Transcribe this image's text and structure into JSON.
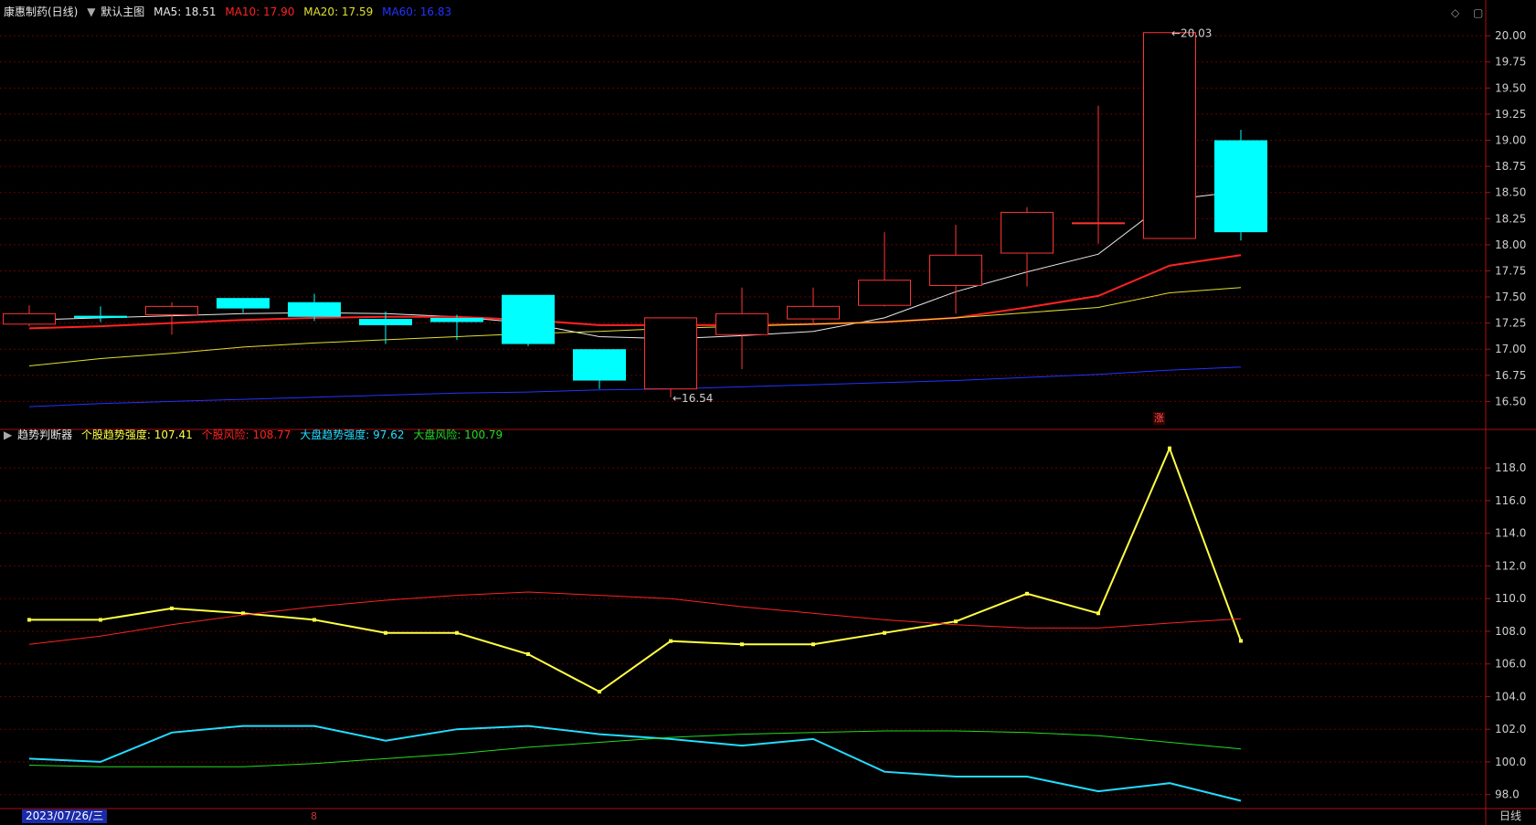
{
  "top_header": {
    "title": "康惠制药(日线)",
    "template_label": "默认主图",
    "indicators": [
      {
        "label": "MA5: 18.51",
        "color": "#e8e8e8"
      },
      {
        "label": "MA10: 17.90",
        "color": "#ff2222"
      },
      {
        "label": "MA20: 17.59",
        "color": "#e0e030"
      },
      {
        "label": "MA60: 16.83",
        "color": "#2233ff"
      }
    ]
  },
  "bottom_header": {
    "title": "趋势判断器",
    "indicators": [
      {
        "label": "个股趋势强度: 107.41",
        "color": "#ffff44"
      },
      {
        "label": "个股风险: 108.77",
        "color": "#ff2222"
      },
      {
        "label": "大盘趋势强度: 97.62",
        "color": "#22ddff"
      },
      {
        "label": "大盘风险: 100.79",
        "color": "#22dd22"
      }
    ]
  },
  "controls": {
    "diamond_icon": "◇",
    "window_icon": "▢"
  },
  "footer": {
    "date": "2023/07/26/三",
    "period": "日线",
    "axis_marker": "8"
  },
  "rise_badge": "涨",
  "colors": {
    "up": "#ff3333",
    "down": "#00ffff",
    "grid": "#6a0000",
    "frame": "#aa1111",
    "axis_text": "#d0d0d0",
    "ma5": "#e8e8e8",
    "ma10": "#ff2222",
    "ma20": "#e0e030",
    "ma60": "#2233ff",
    "strength": "#ffff44",
    "risk": "#ff2222",
    "mkt_strength": "#22ddff",
    "mkt_risk": "#22dd22"
  },
  "chart_data": [
    {
      "type": "candlestick",
      "title": "康惠制药(日线)",
      "ylim": [
        16.25,
        20.15
      ],
      "yticks": [
        "20.00",
        "19.75",
        "19.50",
        "19.25",
        "19.00",
        "18.75",
        "18.50",
        "18.25",
        "18.00",
        "17.75",
        "17.50",
        "17.25",
        "17.00",
        "16.75",
        "16.50"
      ],
      "candles": [
        {
          "open": 17.24,
          "close": 17.34,
          "high": 17.42,
          "low": 17.22
        },
        {
          "open": 17.32,
          "close": 17.3,
          "high": 17.41,
          "low": 17.26
        },
        {
          "open": 17.33,
          "close": 17.41,
          "high": 17.45,
          "low": 17.14
        },
        {
          "open": 17.49,
          "close": 17.39,
          "high": 17.49,
          "low": 17.35
        },
        {
          "open": 17.45,
          "close": 17.31,
          "high": 17.53,
          "low": 17.27
        },
        {
          "open": 17.29,
          "close": 17.23,
          "high": 17.36,
          "low": 17.05
        },
        {
          "open": 17.3,
          "close": 17.26,
          "high": 17.33,
          "low": 17.09
        },
        {
          "open": 17.52,
          "close": 17.05,
          "high": 17.52,
          "low": 17.03
        },
        {
          "open": 17.0,
          "close": 16.7,
          "high": 17.0,
          "low": 16.62
        },
        {
          "open": 16.62,
          "close": 17.3,
          "high": 17.3,
          "low": 16.54
        },
        {
          "open": 17.14,
          "close": 17.34,
          "high": 17.59,
          "low": 16.81
        },
        {
          "open": 17.29,
          "close": 17.41,
          "high": 17.59,
          "low": 17.23
        },
        {
          "open": 17.42,
          "close": 17.66,
          "high": 18.12,
          "low": 17.41
        },
        {
          "open": 17.61,
          "close": 17.9,
          "high": 18.19,
          "low": 17.34
        },
        {
          "open": 17.92,
          "close": 18.31,
          "high": 18.36,
          "low": 17.6
        },
        {
          "open": 18.21,
          "close": 18.21,
          "high": 19.33,
          "low": 18.01
        },
        {
          "open": 18.06,
          "close": 20.03,
          "high": 20.03,
          "low": 18.06
        },
        {
          "open": 19.0,
          "close": 18.12,
          "high": 19.1,
          "low": 18.04
        }
      ],
      "series": [
        {
          "name": "MA5",
          "values": [
            17.28,
            17.3,
            17.32,
            17.34,
            17.35,
            17.34,
            17.31,
            17.25,
            17.12,
            17.1,
            17.13,
            17.17,
            17.3,
            17.55,
            17.74,
            17.91,
            18.43,
            18.51
          ]
        },
        {
          "name": "MA10",
          "values": [
            17.2,
            17.22,
            17.25,
            17.28,
            17.3,
            17.31,
            17.31,
            17.28,
            17.23,
            17.23,
            17.23,
            17.24,
            17.26,
            17.3,
            17.4,
            17.51,
            17.8,
            17.9
          ]
        },
        {
          "name": "MA20",
          "values": [
            16.84,
            16.91,
            16.96,
            17.02,
            17.06,
            17.09,
            17.12,
            17.15,
            17.17,
            17.2,
            17.22,
            17.24,
            17.26,
            17.3,
            17.35,
            17.4,
            17.54,
            17.59
          ]
        },
        {
          "name": "MA60",
          "values": [
            16.45,
            16.48,
            16.5,
            16.52,
            16.54,
            16.56,
            16.58,
            16.59,
            16.61,
            16.62,
            16.64,
            16.66,
            16.68,
            16.7,
            16.73,
            16.76,
            16.8,
            16.83
          ]
        }
      ],
      "annotations": [
        {
          "label": "20.03",
          "candle": 16,
          "price": 20.03,
          "side": "right"
        },
        {
          "label": "16.54",
          "candle": 9,
          "price": 16.54,
          "side": "right"
        }
      ]
    },
    {
      "type": "line",
      "title": "趋势判断器",
      "ylim": [
        97.2,
        119.8
      ],
      "yticks": [
        "118.0",
        "116.0",
        "114.0",
        "112.0",
        "110.0",
        "108.0",
        "106.0",
        "104.0",
        "102.0",
        "100.0",
        "98.0"
      ],
      "series": [
        {
          "name": "个股趋势强度",
          "values": [
            108.7,
            108.7,
            109.4,
            109.1,
            108.7,
            107.9,
            107.9,
            106.6,
            104.3,
            107.4,
            107.2,
            107.2,
            107.9,
            108.6,
            110.3,
            109.1,
            119.2,
            107.41
          ],
          "markers": true
        },
        {
          "name": "个股风险",
          "values": [
            107.2,
            107.7,
            108.4,
            109.0,
            109.5,
            109.9,
            110.2,
            110.4,
            110.2,
            110.0,
            109.5,
            109.1,
            108.7,
            108.4,
            108.2,
            108.2,
            108.5,
            108.77
          ]
        },
        {
          "name": "大盘趋势强度",
          "values": [
            100.2,
            100.0,
            101.8,
            102.2,
            102.2,
            101.3,
            102.0,
            102.2,
            101.7,
            101.4,
            101.0,
            101.4,
            99.4,
            99.1,
            99.1,
            98.2,
            98.7,
            97.62
          ]
        },
        {
          "name": "大盘风险",
          "values": [
            99.8,
            99.7,
            99.7,
            99.7,
            99.9,
            100.2,
            100.5,
            100.9,
            101.2,
            101.5,
            101.7,
            101.8,
            101.9,
            101.9,
            101.8,
            101.6,
            101.2,
            100.79
          ]
        }
      ]
    }
  ]
}
